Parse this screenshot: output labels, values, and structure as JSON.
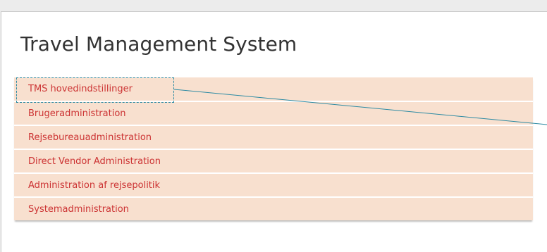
{
  "app": {
    "title": "Travel Management System"
  },
  "menu": {
    "items": [
      {
        "label": "TMS hovedindstillinger"
      },
      {
        "label": "Brugeradministration"
      },
      {
        "label": "Rejsebureauadministration"
      },
      {
        "label": "Direct Vendor Administration"
      },
      {
        "label": "Administration af rejsepolitik"
      },
      {
        "label": "Systemadministration"
      }
    ]
  },
  "colors": {
    "menu_background": "#f8e0cf",
    "menu_text": "#cc3333",
    "callout": "#2c8aa3"
  }
}
